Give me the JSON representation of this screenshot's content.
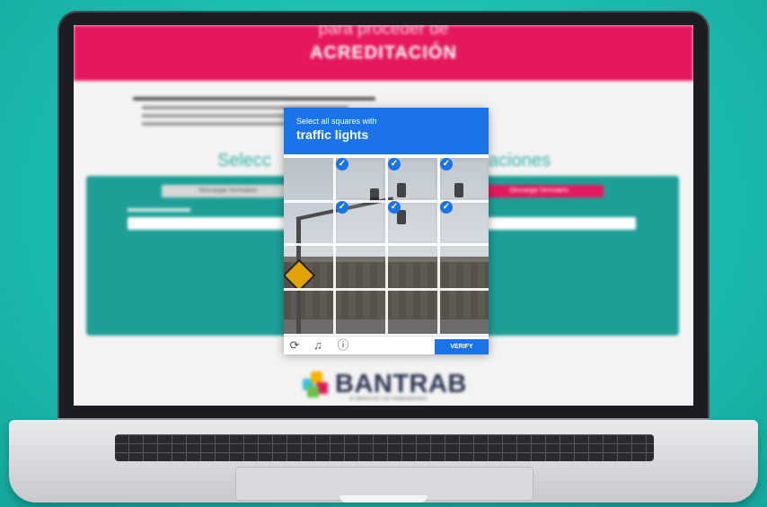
{
  "site": {
    "header_pre": "para proceder de",
    "header_title": "ACREDITACIÓN",
    "select_left": "Selecc",
    "select_right": "aciones",
    "btn_download": "Descargar formulario",
    "btn_download_pink": "Descargar formulario",
    "logo_word": "BANTRAB",
    "logo_tag": "EL BANCO DE LOS TRABAJADORES"
  },
  "captcha": {
    "instruction": "Select all squares with",
    "target": "traffic lights",
    "verify_label": "VERIFY",
    "check_glyph": "✓",
    "selected_tiles": 6,
    "icons": [
      "reload-icon",
      "audio-icon",
      "info-icon"
    ]
  },
  "colors": {
    "background": "#1bbcb1",
    "header": "#e5185f",
    "captcha_blue": "#1a73e8",
    "site_teal": "#1d9f97"
  }
}
